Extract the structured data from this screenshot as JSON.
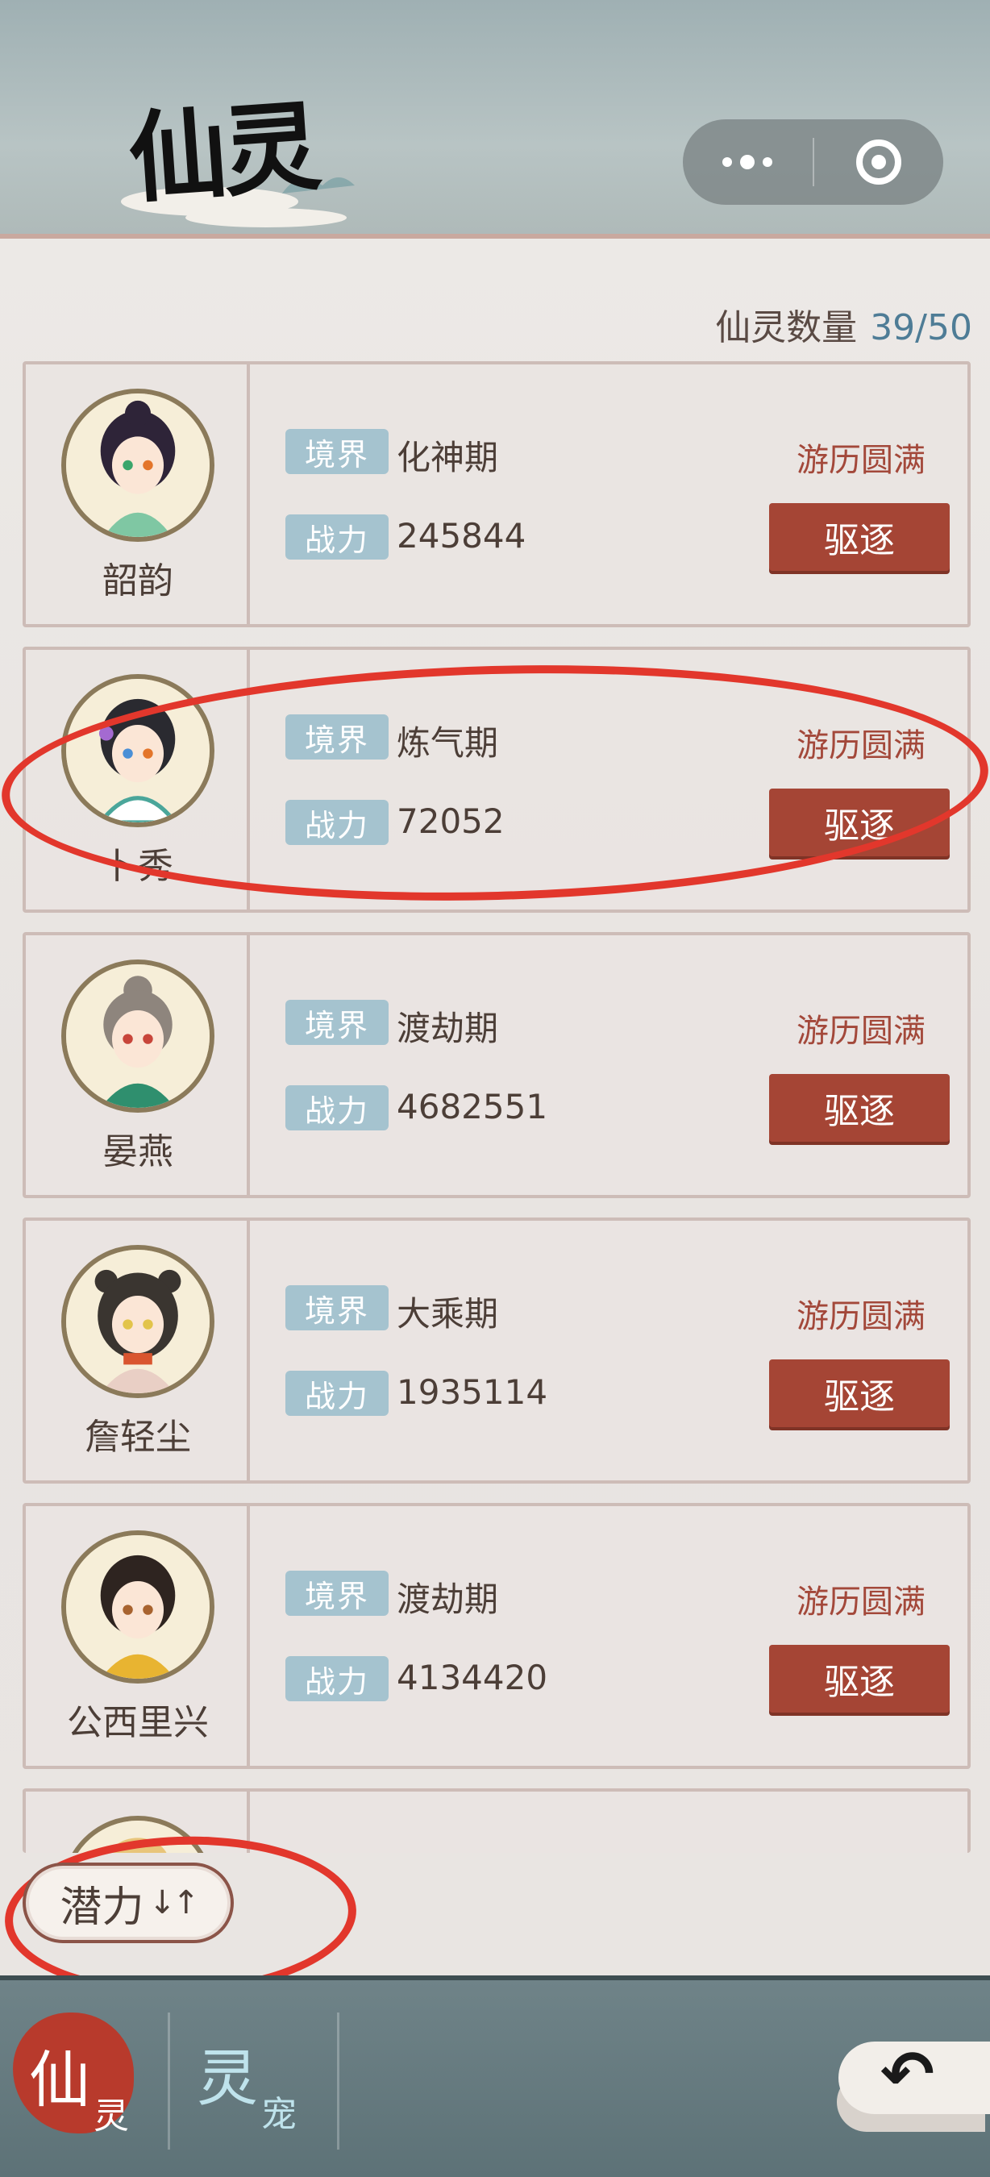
{
  "header": {
    "title": "仙灵",
    "capsule": {
      "more_icon": "more-dots-icon",
      "close_icon": "target-circle-icon"
    }
  },
  "summary": {
    "label": "仙灵数量",
    "value": "39/50"
  },
  "cards": [
    {
      "name": "韶韵",
      "realm_tag": "境界",
      "realm": "化神期",
      "power_tag": "战力",
      "power": "245844",
      "status": "游历圆满",
      "action": "驱逐"
    },
    {
      "name": "卜秀",
      "realm_tag": "境界",
      "realm": "炼气期",
      "power_tag": "战力",
      "power": "72052",
      "status": "游历圆满",
      "action": "驱逐"
    },
    {
      "name": "晏燕",
      "realm_tag": "境界",
      "realm": "渡劫期",
      "power_tag": "战力",
      "power": "4682551",
      "status": "游历圆满",
      "action": "驱逐"
    },
    {
      "name": "詹轻尘",
      "realm_tag": "境界",
      "realm": "大乘期",
      "power_tag": "战力",
      "power": "1935114",
      "status": "游历圆满",
      "action": "驱逐"
    },
    {
      "name": "公西里兴",
      "realm_tag": "境界",
      "realm": "渡劫期",
      "power_tag": "战力",
      "power": "4134420",
      "status": "游历圆满",
      "action": "驱逐"
    }
  ],
  "sort": {
    "label": "潜力",
    "arrows": "↓↑"
  },
  "bottom_nav": {
    "tab1_big": "仙",
    "tab1_small": "灵",
    "tab2_big": "灵",
    "tab2_small": "宠",
    "back_icon": "back-arrow-icon"
  },
  "colors": {
    "accent_red": "#a54535",
    "tag_blue": "#a5c3cf",
    "annotation_red": "#e2372c"
  }
}
